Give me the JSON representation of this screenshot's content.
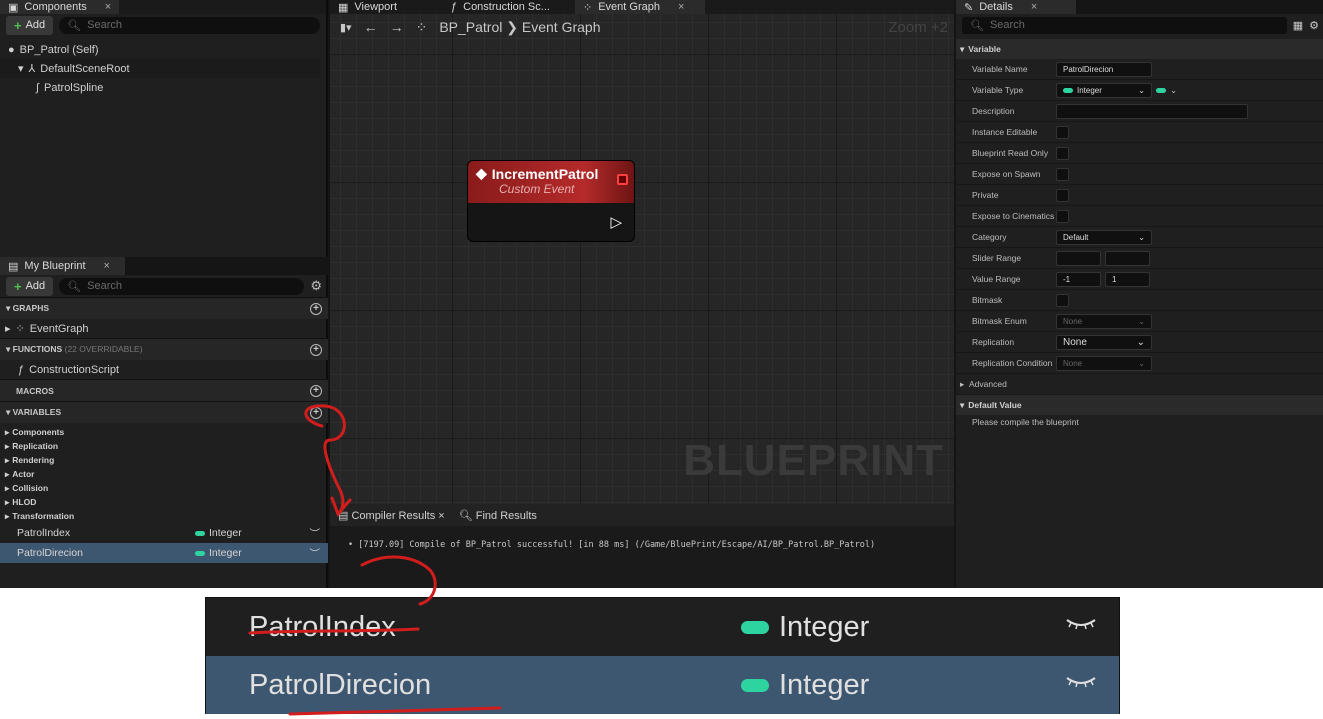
{
  "components": {
    "tab": "Components",
    "add": "Add",
    "search_placeholder": "Search",
    "items": [
      "BP_Patrol (Self)",
      "DefaultSceneRoot",
      "PatrolSpline"
    ]
  },
  "center_tabs": [
    "Viewport",
    "Construction Sc...",
    "Event Graph"
  ],
  "details_tab": "Details",
  "my_blueprint": {
    "tab": "My Blueprint",
    "add": "Add",
    "search_placeholder": "Search",
    "graphs": "GRAPHS",
    "event_graph": "EventGraph",
    "functions": "FUNCTIONS",
    "functions_sub": "(22 OVERRIDABLE)",
    "construction": "ConstructionScript",
    "macros": "MACROS",
    "variables": "VARIABLES",
    "categories": [
      "Components",
      "Replication",
      "Rendering",
      "Actor",
      "Collision",
      "HLOD",
      "Transformation"
    ],
    "vars": [
      {
        "name": "PatrolIndex",
        "type": "Integer"
      },
      {
        "name": "PatrolDirecion",
        "type": "Integer"
      }
    ]
  },
  "graph": {
    "breadcrumb_bp": "BP_Patrol",
    "breadcrumb_graph": "Event Graph",
    "zoom": "Zoom +2",
    "node_title": "IncrementPatrol",
    "node_sub": "Custom Event",
    "watermark": "BLUEPRINT"
  },
  "compiler": {
    "tab": "Compiler Results",
    "find": "Find Results",
    "message": "[7197.09] Compile of BP_Patrol successful! [in 88 ms] (/Game/BluePrint/Escape/AI/BP_Patrol.BP_Patrol)"
  },
  "details": {
    "search_placeholder": "Search",
    "section_variable": "Variable",
    "rows": [
      {
        "label": "Variable Name",
        "value": "PatrolDirecion"
      },
      {
        "label": "Variable Type",
        "value": "Integer"
      },
      {
        "label": "Description"
      },
      {
        "label": "Instance Editable"
      },
      {
        "label": "Blueprint Read Only"
      },
      {
        "label": "Expose on Spawn"
      },
      {
        "label": "Private"
      },
      {
        "label": "Expose to Cinematics"
      },
      {
        "label": "Category",
        "value": "Default"
      },
      {
        "label": "Slider Range"
      },
      {
        "label": "Value Range",
        "min": "-1",
        "max": "1"
      },
      {
        "label": "Bitmask"
      },
      {
        "label": "Bitmask Enum",
        "value": "None"
      },
      {
        "label": "Replication",
        "value": "None"
      },
      {
        "label": "Replication Condition",
        "value": "None"
      }
    ],
    "advanced": "Advanced",
    "section_default": "Default Value",
    "compile_msg": "Please compile the blueprint"
  },
  "zoom": {
    "vars": [
      {
        "name": "PatrolIndex",
        "type": "Integer"
      },
      {
        "name": "PatrolDirecion",
        "type": "Integer"
      }
    ]
  },
  "colors": {
    "selection": "#3e5771",
    "integer_pin": "#2ed4a0",
    "event_node": "#b52a2a",
    "annotation": "#d21d1d"
  }
}
